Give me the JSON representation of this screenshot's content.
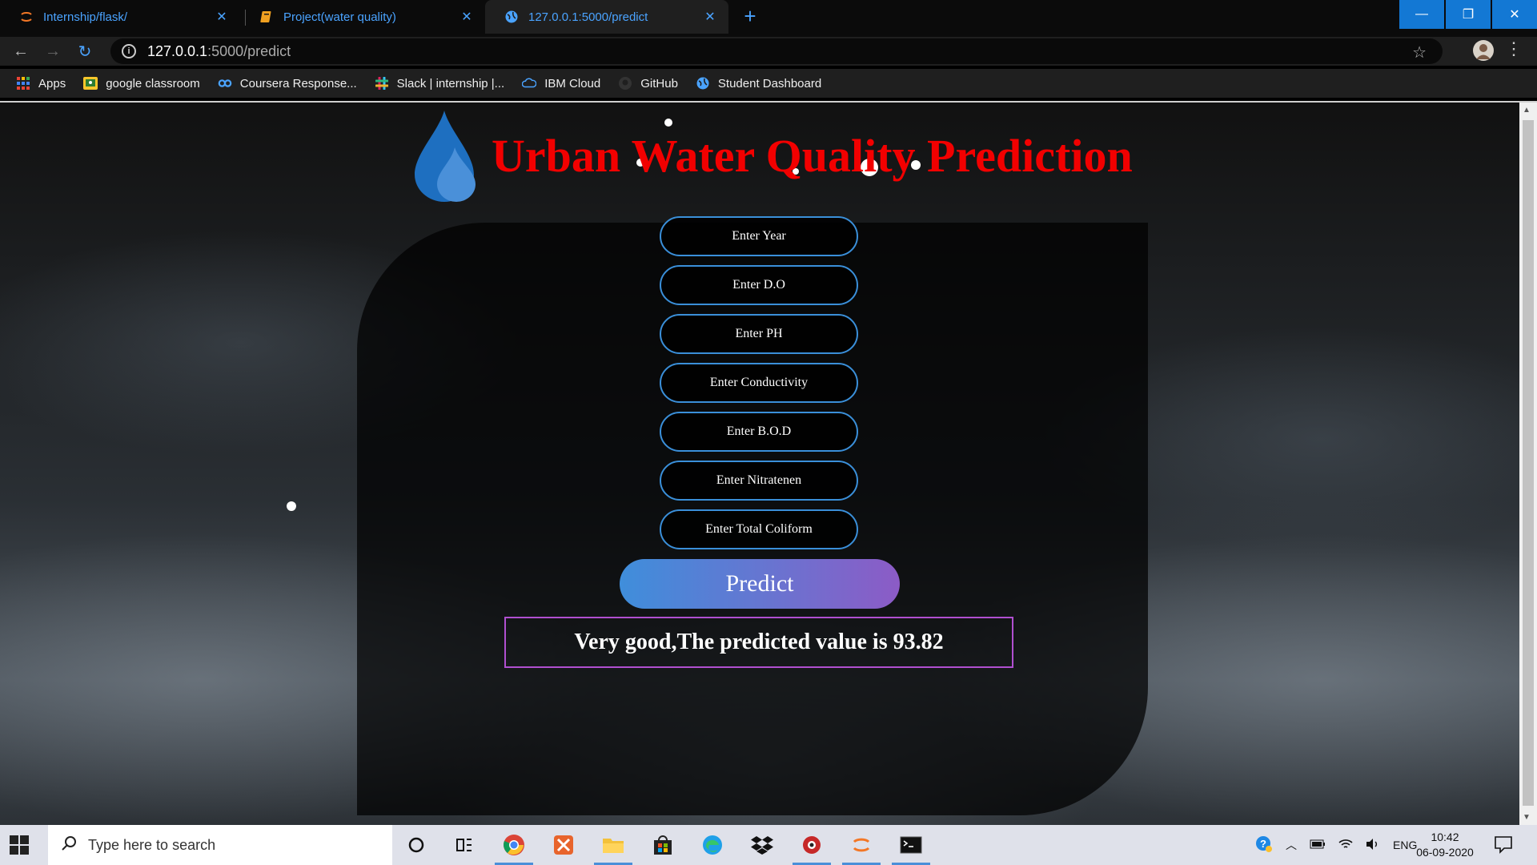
{
  "browser": {
    "tabs": [
      {
        "label": "Internship/flask/",
        "icon": "jupyter-icon",
        "active": false
      },
      {
        "label": "Project(water quality)",
        "icon": "notebook-icon",
        "active": false
      },
      {
        "label": "127.0.0.1:5000/predict",
        "icon": "globe-icon",
        "active": true
      }
    ],
    "close_glyph": "✕",
    "new_tab_glyph": "+",
    "window_controls": {
      "minimize": "—",
      "restore": "❐",
      "close": "✕"
    },
    "url_host": "127.0.0.1",
    "url_path": ":5000/predict",
    "bookmarks": [
      {
        "label": "Apps",
        "icon": "apps-grid-icon"
      },
      {
        "label": "google classroom",
        "icon": "classroom-icon"
      },
      {
        "label": "Coursera Response...",
        "icon": "coursera-icon"
      },
      {
        "label": "Slack | internship |...",
        "icon": "slack-icon"
      },
      {
        "label": "IBM Cloud",
        "icon": "ibm-cloud-icon"
      },
      {
        "label": "GitHub",
        "icon": "github-icon"
      },
      {
        "label": "Student Dashboard",
        "icon": "globe-icon"
      }
    ]
  },
  "page": {
    "title": "Urban Water Quality Prediction",
    "fields": [
      {
        "placeholder": "Enter Year"
      },
      {
        "placeholder": "Enter D.O"
      },
      {
        "placeholder": "Enter PH"
      },
      {
        "placeholder": "Enter Conductivity"
      },
      {
        "placeholder": "Enter B.O.D"
      },
      {
        "placeholder": "Enter Nitratenen"
      },
      {
        "placeholder": "Enter Total Coliform"
      }
    ],
    "predict_label": "Predict",
    "result_text": "Very good,The predicted value is 93.82",
    "colors": {
      "title": "#f20000",
      "field_border": "#3a8fd9",
      "result_border": "#b04fd0"
    }
  },
  "taskbar": {
    "search_placeholder": "Type here to search",
    "apps": [
      "cortana-icon",
      "task-view-icon",
      "chrome-icon",
      "app-icon",
      "file-explorer-icon",
      "store-icon",
      "edge-icon",
      "dropbox-icon",
      "app-icon",
      "jupyter-icon",
      "terminal-icon"
    ],
    "tray_lang": "ENG",
    "time": "10:42",
    "date": "06-09-2020"
  }
}
